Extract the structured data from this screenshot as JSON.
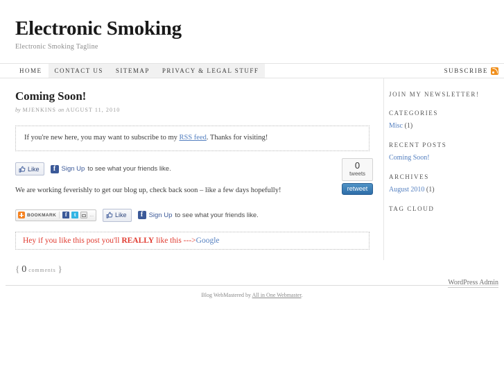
{
  "site": {
    "title": "Electronic Smoking",
    "tagline": "Electronic Smoking Tagline"
  },
  "nav": {
    "items": [
      {
        "label": "Home",
        "highlighted": false
      },
      {
        "label": "Contact Us",
        "highlighted": true
      },
      {
        "label": "Sitemap",
        "highlighted": true
      },
      {
        "label": "Privacy & Legal Stuff",
        "highlighted": true
      }
    ],
    "subscribe_label": "Subscribe",
    "rss_icon": "rss-feed-icon"
  },
  "post": {
    "title": "Coming Soon!",
    "meta_by": "by",
    "meta_author": "MJENKINS",
    "meta_on": "on",
    "meta_date": "AUGUST 11, 2010",
    "notice_prefix": "If you're new here, you may want to subscribe to my ",
    "notice_link": "RSS feed",
    "notice_suffix": ". Thanks for visiting!",
    "body": "We are working feverishly to get our blog up, check back soon – like a few days hopefully!",
    "promo_prefix": "Hey if you like this post you'll ",
    "promo_strong": "REALLY",
    "promo_middle": " like this --->",
    "promo_link": "Google",
    "comments_open_brace": "{",
    "comments_count": "0",
    "comments_word": "comments",
    "comments_close_brace": "}"
  },
  "social": {
    "like_label": "Like",
    "thumb_icon": "thumbs-up-icon",
    "fb_badge": "f",
    "signup_link": "Sign Up",
    "signup_rest": " to see what your friends like.",
    "bookmark_label": "BOOKMARK",
    "bookmark_plus_icon": "plus-icon",
    "share_facebook_icon": "facebook-icon",
    "share_twitter_icon": "twitter-icon",
    "share_email_icon": "email-icon",
    "share_more": "..."
  },
  "tweet_widget": {
    "count": "0",
    "count_label": "tweets",
    "button_label": "retweet",
    "button_color": "#3778b0"
  },
  "sidebar": {
    "widgets": [
      {
        "title": "Join my newsletter!",
        "items": []
      },
      {
        "title": "Categories",
        "items": [
          {
            "link": "Misc",
            "suffix": " (1)"
          }
        ]
      },
      {
        "title": "Recent Posts",
        "items": [
          {
            "link": "Coming Soon!",
            "suffix": ""
          }
        ]
      },
      {
        "title": "Archives",
        "items": [
          {
            "link": "August 2010",
            "suffix": " (1)"
          }
        ]
      },
      {
        "title": "Tag Cloud",
        "items": []
      }
    ]
  },
  "footer": {
    "wp_admin": "WordPress Admin",
    "credit_prefix": "Blog WebMastered by ",
    "credit_link": "All in One Webmaster",
    "credit_suffix": "."
  },
  "colors": {
    "accent_blue": "#5580c0",
    "promo_red": "#e03a2f",
    "rss_orange": "#f0901e",
    "facebook_blue": "#3b5998"
  }
}
